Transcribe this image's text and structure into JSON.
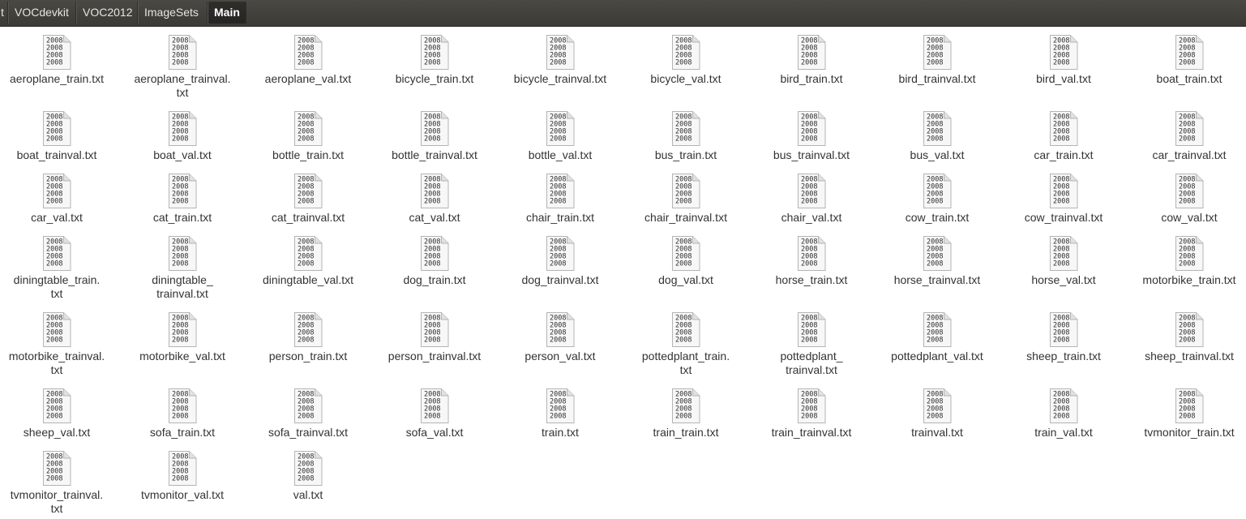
{
  "breadcrumb": [
    "t",
    "VOCdevkit",
    "VOC2012",
    "ImageSets",
    "Main"
  ],
  "breadcrumb_active": 4,
  "icon": {
    "name": "text-file-icon",
    "preview_text": "2008"
  },
  "files": [
    [
      "aeroplane_train.txt"
    ],
    [
      "aeroplane_trainval.",
      "txt"
    ],
    [
      "aeroplane_val.txt"
    ],
    [
      "bicycle_train.txt"
    ],
    [
      "bicycle_trainval.txt"
    ],
    [
      "bicycle_val.txt"
    ],
    [
      "bird_train.txt"
    ],
    [
      "bird_trainval.txt"
    ],
    [
      "bird_val.txt"
    ],
    [
      "boat_train.txt"
    ],
    [
      "boat_trainval.txt"
    ],
    [
      "boat_val.txt"
    ],
    [
      "bottle_train.txt"
    ],
    [
      "bottle_trainval.txt"
    ],
    [
      "bottle_val.txt"
    ],
    [
      "bus_train.txt"
    ],
    [
      "bus_trainval.txt"
    ],
    [
      "bus_val.txt"
    ],
    [
      "car_train.txt"
    ],
    [
      "car_trainval.txt"
    ],
    [
      "car_val.txt"
    ],
    [
      "cat_train.txt"
    ],
    [
      "cat_trainval.txt"
    ],
    [
      "cat_val.txt"
    ],
    [
      "chair_train.txt"
    ],
    [
      "chair_trainval.txt"
    ],
    [
      "chair_val.txt"
    ],
    [
      "cow_train.txt"
    ],
    [
      "cow_trainval.txt"
    ],
    [
      "cow_val.txt"
    ],
    [
      "diningtable_train.",
      "txt"
    ],
    [
      "diningtable_",
      "trainval.txt"
    ],
    [
      "diningtable_val.txt"
    ],
    [
      "dog_train.txt"
    ],
    [
      "dog_trainval.txt"
    ],
    [
      "dog_val.txt"
    ],
    [
      "horse_train.txt"
    ],
    [
      "horse_trainval.txt"
    ],
    [
      "horse_val.txt"
    ],
    [
      "motorbike_train.txt"
    ],
    [
      "motorbike_trainval.",
      "txt"
    ],
    [
      "motorbike_val.txt"
    ],
    [
      "person_train.txt"
    ],
    [
      "person_trainval.txt"
    ],
    [
      "person_val.txt"
    ],
    [
      "pottedplant_train.",
      "txt"
    ],
    [
      "pottedplant_",
      "trainval.txt"
    ],
    [
      "pottedplant_val.txt"
    ],
    [
      "sheep_train.txt"
    ],
    [
      "sheep_trainval.txt"
    ],
    [
      "sheep_val.txt"
    ],
    [
      "sofa_train.txt"
    ],
    [
      "sofa_trainval.txt"
    ],
    [
      "sofa_val.txt"
    ],
    [
      "train.txt"
    ],
    [
      "train_train.txt"
    ],
    [
      "train_trainval.txt"
    ],
    [
      "trainval.txt"
    ],
    [
      "train_val.txt"
    ],
    [
      "tvmonitor_train.txt"
    ],
    [
      "tvmonitor_trainval.",
      "txt"
    ],
    [
      "tvmonitor_val.txt"
    ],
    [
      "val.txt"
    ]
  ]
}
